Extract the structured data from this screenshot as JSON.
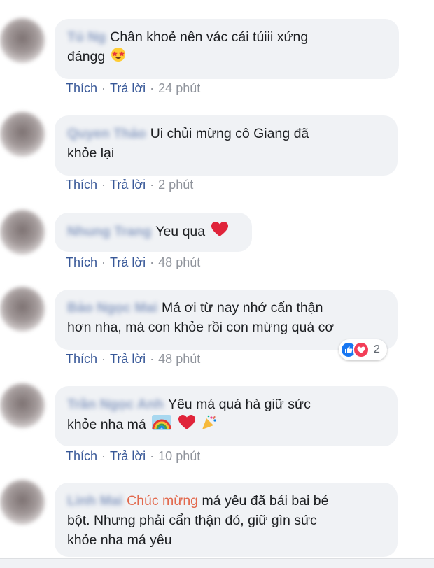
{
  "comments": [
    {
      "author": "Tú Ng",
      "lines": [
        "Chân khoẻ nên vác cái túiii xứng",
        "đángg"
      ],
      "like_label": "Thích",
      "reply_label": "Trả lời",
      "time": "24 phút"
    },
    {
      "author": "Quyen Thảo",
      "lines": [
        "Ui chủi mừng cô Giang đã",
        "khỏe lại"
      ],
      "like_label": "Thích",
      "reply_label": "Trả lời",
      "time": "2 phút"
    },
    {
      "author": "Nhung Trang",
      "lines": [
        "Yeu qua"
      ],
      "like_label": "Thích",
      "reply_label": "Trả lời",
      "time": "48 phút"
    },
    {
      "author": "Bảo Ngọc Mai",
      "lines": [
        "Má ơi từ nay nhớ cẩn thận",
        "hơn nha, má con khỏe rồi con mừng quá cơ"
      ],
      "like_label": "Thích",
      "reply_label": "Trả lời",
      "time": "48 phút",
      "reaction_count": "2"
    },
    {
      "author": "Trần Ngọc Anh",
      "lines": [
        "Yêu má quá hà giữ sức",
        "khỏe nha má"
      ],
      "like_label": "Thích",
      "reply_label": "Trả lời",
      "time": "10 phút"
    },
    {
      "author": "Linh Mai",
      "highlight": "Chúc mừng",
      "lines": [
        "má yêu đã bái bai bé",
        "bột. Nhưng phải cẩn thận đó, giữ gìn sức",
        "khỏe nha má yêu"
      ]
    }
  ],
  "colors": {
    "link": "#385898",
    "meta": "#90949c",
    "bubble": "#f0f2f5",
    "highlight": "#e2684c",
    "like": "#1877f2",
    "love": "#f33e58"
  },
  "icons": [
    "star-struck-emoji-icon",
    "heart-emoji-icon",
    "rainbow-emoji-icon",
    "party-popper-emoji-icon",
    "like-reaction-icon",
    "love-reaction-icon"
  ]
}
